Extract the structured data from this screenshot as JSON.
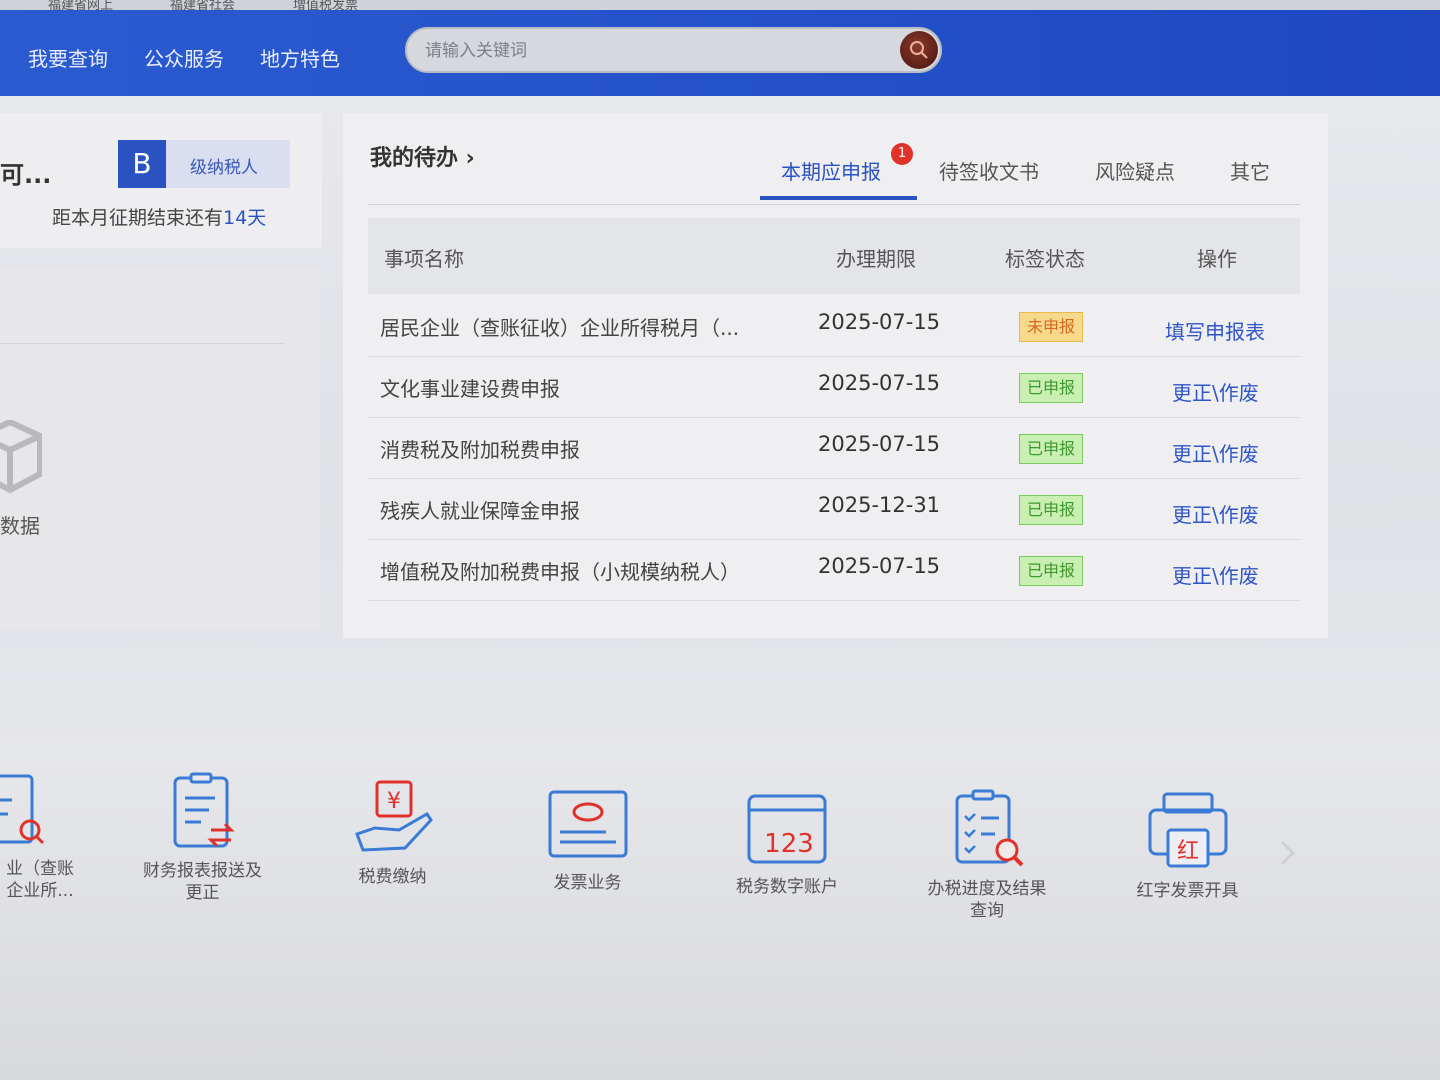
{
  "browser_tabs": [
    "福建省网上",
    "福建省社会",
    "增值税发票"
  ],
  "nav": {
    "items": [
      "我要查询",
      "公众服务",
      "地方特色"
    ],
    "search_placeholder": "请输入关键词"
  },
  "account": {
    "title_fragment": "可...",
    "taxpayer_letter": "B",
    "taxpayer_level": "级纳税人",
    "deadline_prefix": "距本月征期结束还有",
    "deadline_days": "14天"
  },
  "left_shortcut": {
    "label_fragment": "数据"
  },
  "todo": {
    "title": "我的待办 ›",
    "tabs": [
      {
        "label": "本期应申报",
        "badge": "1",
        "active": true
      },
      {
        "label": "待签收文书",
        "active": false
      },
      {
        "label": "风险疑点",
        "active": false
      },
      {
        "label": "其它",
        "active": false
      }
    ],
    "columns": [
      "事项名称",
      "办理期限",
      "标签状态",
      "操作"
    ],
    "rows": [
      {
        "name": "居民企业（查账征收）企业所得税月（...",
        "deadline": "2025-07-15",
        "status": "未申报",
        "status_type": "pending",
        "action": "填写申报表"
      },
      {
        "name": "文化事业建设费申报",
        "deadline": "2025-07-15",
        "status": "已申报",
        "status_type": "done",
        "action": "更正\\作废"
      },
      {
        "name": "消费税及附加税费申报",
        "deadline": "2025-07-15",
        "status": "已申报",
        "status_type": "done",
        "action": "更正\\作废"
      },
      {
        "name": "残疾人就业保障金申报",
        "deadline": "2025-12-31",
        "status": "已申报",
        "status_type": "done",
        "action": "更正\\作废"
      },
      {
        "name": "增值税及附加税费申报（小规模纳税人）",
        "deadline": "2025-07-15",
        "status": "已申报",
        "status_type": "done",
        "action": "更正\\作废"
      }
    ]
  },
  "services": [
    {
      "label_line1": "业（查账",
      "label_line2": "企业所..."
    },
    {
      "label_line1": "财务报表报送及",
      "label_line2": "更正"
    },
    {
      "label_line1": "税费缴纳",
      "label_line2": ""
    },
    {
      "label_line1": "发票业务",
      "label_line2": ""
    },
    {
      "label_line1": "税务数字账户",
      "label_line2": "",
      "icon_text": "123"
    },
    {
      "label_line1": "办税进度及结果",
      "label_line2": "查询"
    },
    {
      "label_line1": "红字发票开具",
      "label_line2": "",
      "icon_text": "红"
    }
  ],
  "colors": {
    "brand_blue": "#2a52c0",
    "icon_blue": "#3a7bd5",
    "icon_red": "#e0322a",
    "pending": "#d56a1e",
    "done": "#3f9a2e"
  }
}
